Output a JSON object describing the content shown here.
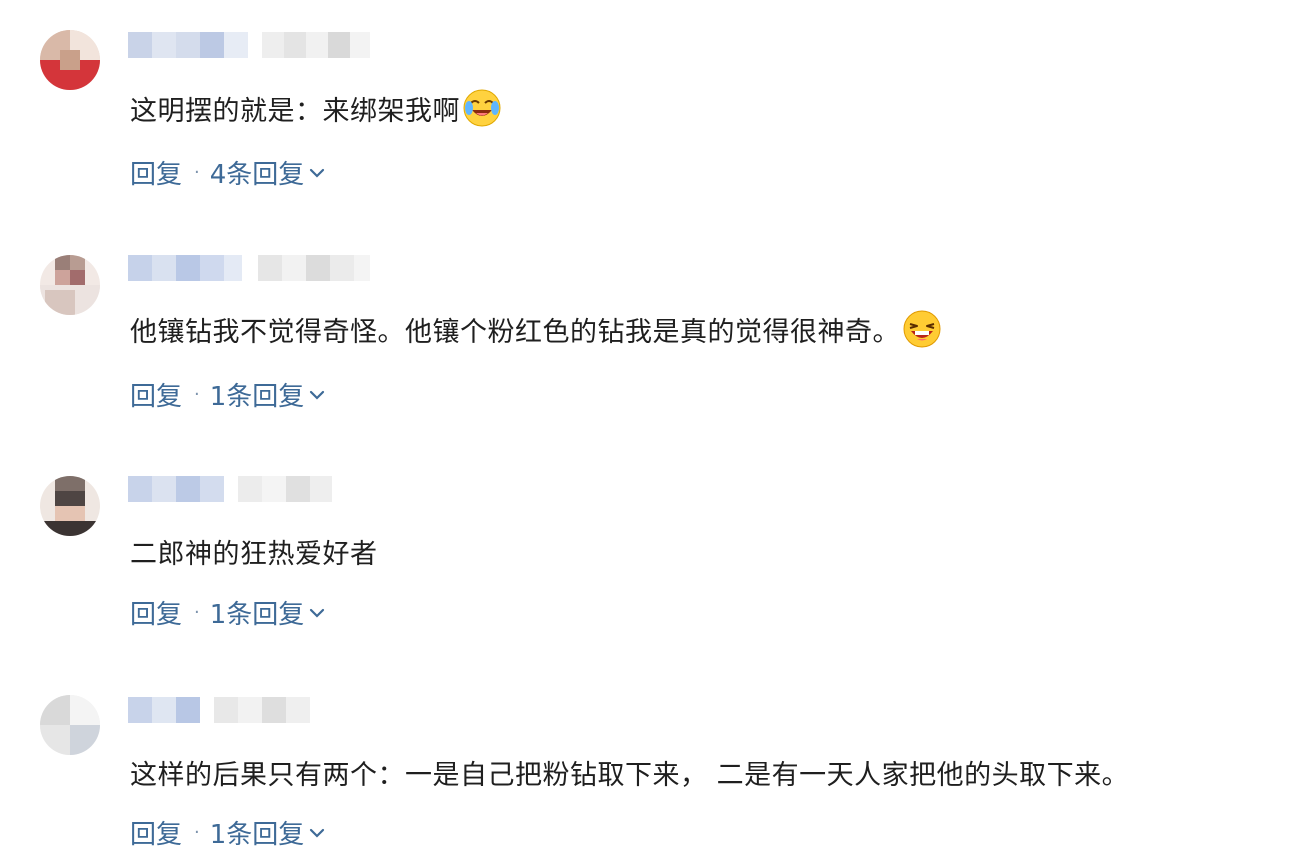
{
  "comments": [
    {
      "text": "这明摆的就是：来绑架我啊",
      "emoji_icon": "crying-laughing-emoji-icon",
      "reply_label": "回复",
      "separator": "·",
      "replies_label": "4条回复"
    },
    {
      "text": "他镶钻我不觉得奇怪。他镶个粉红色的钻我是真的觉得很神奇。",
      "emoji_icon": "laughing-emoji-icon",
      "reply_label": "回复",
      "separator": "·",
      "replies_label": "1条回复"
    },
    {
      "text": "二郎神的狂热爱好者",
      "reply_label": "回复",
      "separator": "·",
      "replies_label": "1条回复"
    },
    {
      "text": "这样的后果只有两个：一是自己把粉钻取下来， 二是有一天人家把他的头取下来。",
      "reply_label": "回复",
      "separator": "·",
      "replies_label": "1条回复"
    }
  ],
  "colors": {
    "link": "#3e6a97",
    "text": "#1f1f1f",
    "background": "#ffffff"
  }
}
